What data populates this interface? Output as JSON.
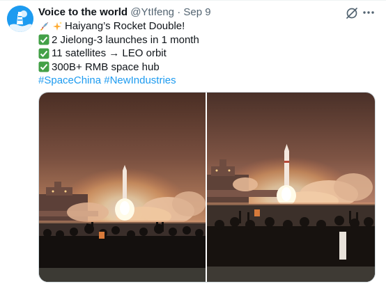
{
  "tweet": {
    "author": {
      "name": "Voice to the world",
      "handle": "@YtIfeng",
      "separator": "·",
      "date": "Sep 9"
    },
    "lines": [
      {
        "emojis": [
          "rocket",
          "sparkles"
        ],
        "text": "Haiyang’s Rocket Double!"
      },
      {
        "emojis": [
          "check-mark"
        ],
        "text": "2 Jielong-3 launches in 1 month"
      },
      {
        "emojis": [
          "check-mark"
        ],
        "text": "11 satellites → LEO orbit"
      },
      {
        "emojis": [
          "check-mark"
        ],
        "text": "300B+ RMB space hub"
      }
    ],
    "hashtags": [
      "#SpaceChina",
      "#NewIndustries"
    ]
  },
  "icons": {
    "grok": "grok-icon",
    "more": "more-icon",
    "avatar": "lighthouse-icon"
  },
  "colors": {
    "link": "#1d9bf0",
    "check": "#43a047",
    "secondary_text": "#536471"
  }
}
